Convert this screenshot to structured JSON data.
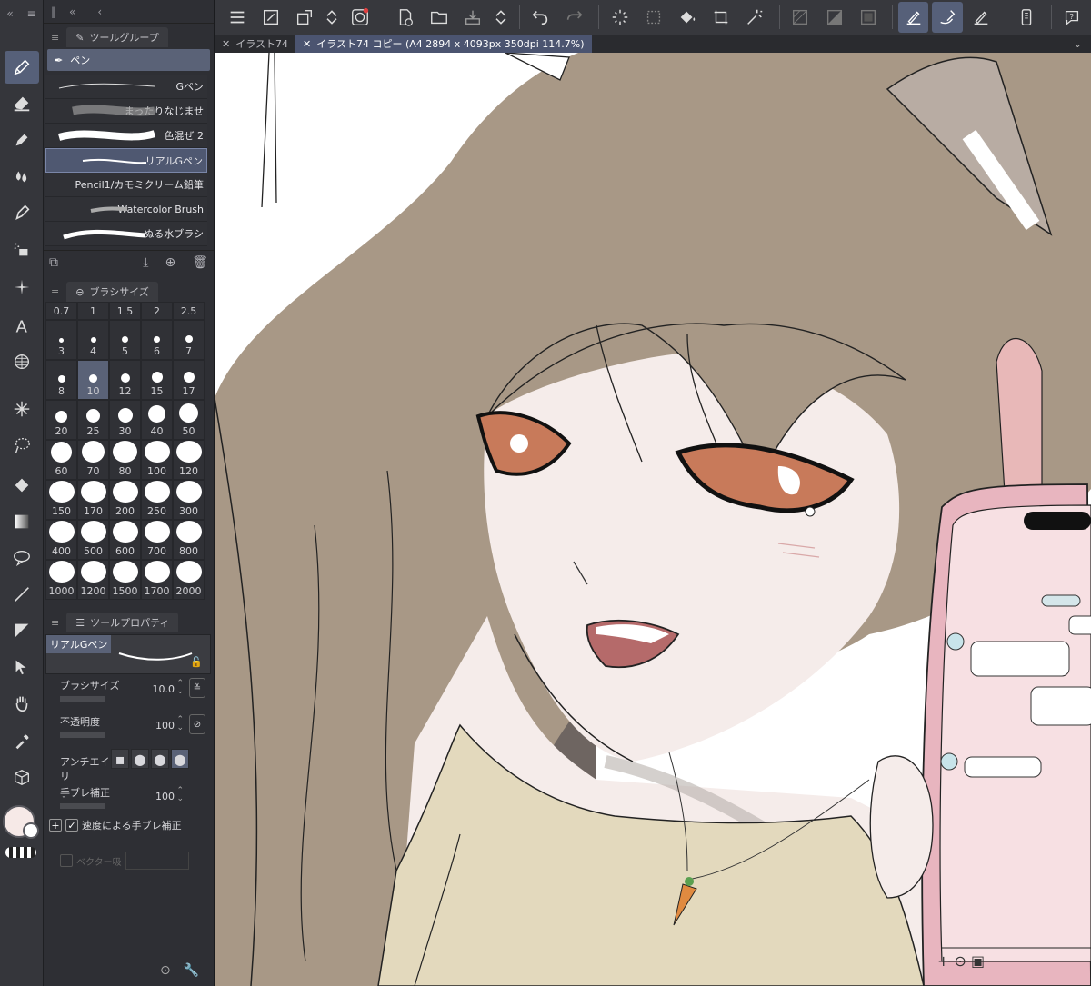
{
  "app": {
    "accent": "#566079"
  },
  "tool_group": {
    "title": "ツールグループ",
    "current": "ペン",
    "brushes": [
      {
        "label": "Gペン"
      },
      {
        "label": "まったりなじませ"
      },
      {
        "label": "色混ぜ 2"
      },
      {
        "label": "リアルGペン",
        "selected": true
      },
      {
        "label": "Pencil1/カモミクリーム鉛筆"
      },
      {
        "label": "Watercolor Brush"
      },
      {
        "label": "ぬる水ブラシ"
      }
    ]
  },
  "brush_size": {
    "title": "ブラシサイズ",
    "sizes": [
      "0.7",
      "1",
      "1.5",
      "2",
      "2.5",
      "3",
      "4",
      "5",
      "6",
      "7",
      "8",
      "10",
      "12",
      "15",
      "17",
      "20",
      "25",
      "30",
      "40",
      "50",
      "60",
      "70",
      "80",
      "100",
      "120",
      "150",
      "170",
      "200",
      "250",
      "300",
      "400",
      "500",
      "600",
      "700",
      "800",
      "1000",
      "1200",
      "1500",
      "1700",
      "2000"
    ],
    "selected": "10"
  },
  "tool_property": {
    "title": "ツールプロパティ",
    "preview_name": "リアルGペン",
    "brush_size_label": "ブラシサイズ",
    "brush_size_value": "10.0",
    "opacity_label": "不透明度",
    "opacity_value": "100",
    "antialias_label": "アンチエイリ",
    "stabilization_label": "手ブレ補正",
    "stabilization_value": "100",
    "speed_stabilization_label": "速度による手ブレ補正",
    "vector_label": "ベクター吸"
  },
  "tabs": [
    {
      "label": "イラスト74",
      "active": false
    },
    {
      "label": "イラスト74 コピー (A4 2894 x 4093px 350dpi 114.7%)",
      "active": true
    }
  ],
  "colors": {
    "main": "#f6e9e7",
    "sub": "#ffffff"
  }
}
